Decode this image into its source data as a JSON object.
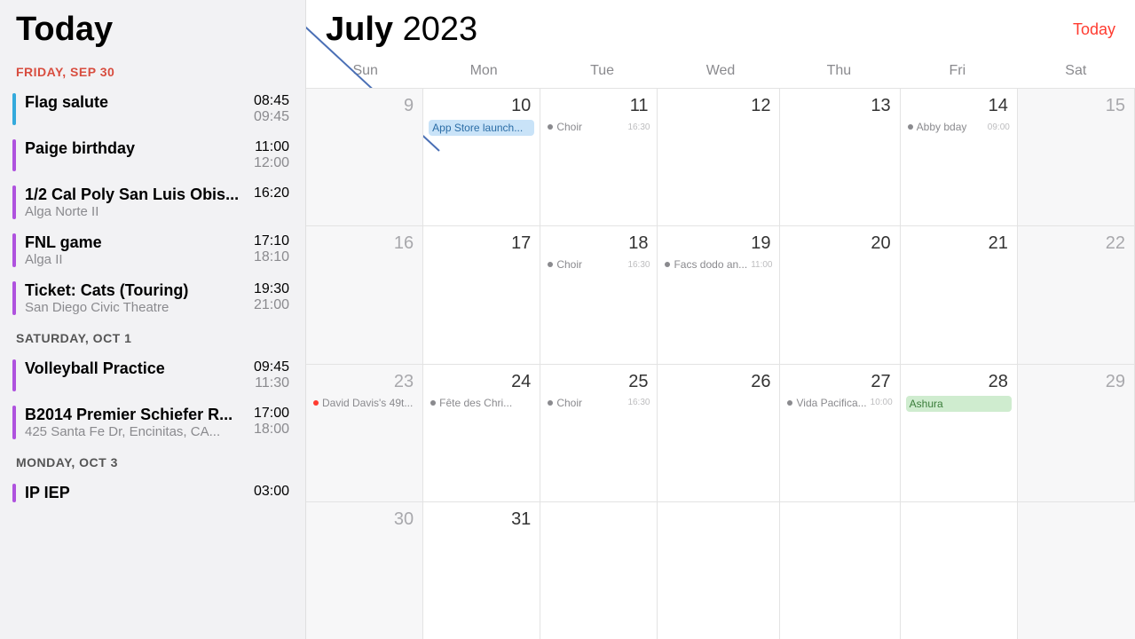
{
  "sidebar": {
    "title": "Today",
    "sections": [
      {
        "header": "FRIDAY, SEP 30",
        "color": "red",
        "events": [
          {
            "title": "Flag salute",
            "sub": "",
            "start": "08:45",
            "end": "09:45",
            "bar": "#34aadc"
          },
          {
            "title": "Paige birthday",
            "sub": "",
            "start": "11:00",
            "end": "12:00",
            "bar": "#af52de"
          },
          {
            "title": "1/2 Cal Poly San Luis Obis...",
            "sub": "Alga Norte II",
            "start": "16:20",
            "end": "",
            "bar": "#af52de"
          },
          {
            "title": "FNL game",
            "sub": "Alga II",
            "start": "17:10",
            "end": "18:10",
            "bar": "#af52de"
          },
          {
            "title": "Ticket: Cats (Touring)",
            "sub": "San Diego Civic Theatre",
            "start": "19:30",
            "end": "21:00",
            "bar": "#af52de"
          }
        ]
      },
      {
        "header": "SATURDAY, OCT 1",
        "color": "gray",
        "events": [
          {
            "title": "Volleyball Practice",
            "sub": "",
            "start": "09:45",
            "end": "11:30",
            "bar": "#af52de"
          },
          {
            "title": "B2014 Premier Schiefer R...",
            "sub": "425 Santa Fe Dr, Encinitas, CA...",
            "start": "17:00",
            "end": "18:00",
            "bar": "#af52de"
          }
        ]
      },
      {
        "header": "MONDAY, OCT 3",
        "color": "gray",
        "events": [
          {
            "title": "IP IEP",
            "sub": "",
            "start": "03:00",
            "end": "",
            "bar": "#af52de"
          }
        ]
      }
    ]
  },
  "main": {
    "month": "July",
    "year": "2023",
    "today_label": "Today",
    "weekdays": [
      "Sun",
      "Mon",
      "Tue",
      "Wed",
      "Thu",
      "Fri",
      "Sat"
    ],
    "weeks": [
      [
        {
          "n": "9",
          "dim": true,
          "weekend": true,
          "items": []
        },
        {
          "n": "10",
          "items": [
            {
              "type": "chip",
              "style": "blue",
              "text": "App Store launch..."
            }
          ]
        },
        {
          "n": "11",
          "items": [
            {
              "type": "mini",
              "dot": "#8a8a8e",
              "text": "Choir",
              "time": "16:30"
            }
          ]
        },
        {
          "n": "12",
          "items": []
        },
        {
          "n": "13",
          "items": []
        },
        {
          "n": "14",
          "items": [
            {
              "type": "mini",
              "dot": "#8a8a8e",
              "text": "Abby bday",
              "time": "09:00"
            }
          ]
        },
        {
          "n": "15",
          "dim": true,
          "weekend": true,
          "items": []
        }
      ],
      [
        {
          "n": "16",
          "dim": true,
          "weekend": true,
          "items": []
        },
        {
          "n": "17",
          "items": []
        },
        {
          "n": "18",
          "items": [
            {
              "type": "mini",
              "dot": "#8a8a8e",
              "text": "Choir",
              "time": "16:30"
            }
          ]
        },
        {
          "n": "19",
          "items": [
            {
              "type": "mini",
              "dot": "#8a8a8e",
              "text": "Facs dodo an...",
              "time": "11:00"
            }
          ]
        },
        {
          "n": "20",
          "items": []
        },
        {
          "n": "21",
          "items": []
        },
        {
          "n": "22",
          "dim": true,
          "weekend": true,
          "items": []
        }
      ],
      [
        {
          "n": "23",
          "dim": true,
          "weekend": true,
          "items": [
            {
              "type": "mini",
              "dot": "#ff3b30",
              "text": "David Davis's 49t...",
              "time": ""
            }
          ]
        },
        {
          "n": "24",
          "items": [
            {
              "type": "mini",
              "dot": "#8a8a8e",
              "text": "Fête des Chri...",
              "time": ""
            }
          ]
        },
        {
          "n": "25",
          "items": [
            {
              "type": "mini",
              "dot": "#8a8a8e",
              "text": "Choir",
              "time": "16:30"
            }
          ]
        },
        {
          "n": "26",
          "items": []
        },
        {
          "n": "27",
          "items": [
            {
              "type": "mini",
              "dot": "#8a8a8e",
              "text": "Vida Pacifica...",
              "time": "10:00"
            }
          ]
        },
        {
          "n": "28",
          "items": [
            {
              "type": "chip",
              "style": "green",
              "text": "Ashura"
            }
          ]
        },
        {
          "n": "29",
          "dim": true,
          "weekend": true,
          "items": []
        }
      ],
      [
        {
          "n": "30",
          "dim": true,
          "weekend": true,
          "items": []
        },
        {
          "n": "31",
          "items": []
        },
        {
          "n": "",
          "items": []
        },
        {
          "n": "",
          "items": []
        },
        {
          "n": "",
          "items": []
        },
        {
          "n": "",
          "items": []
        },
        {
          "n": "",
          "dim": true,
          "weekend": true,
          "items": []
        }
      ]
    ]
  }
}
